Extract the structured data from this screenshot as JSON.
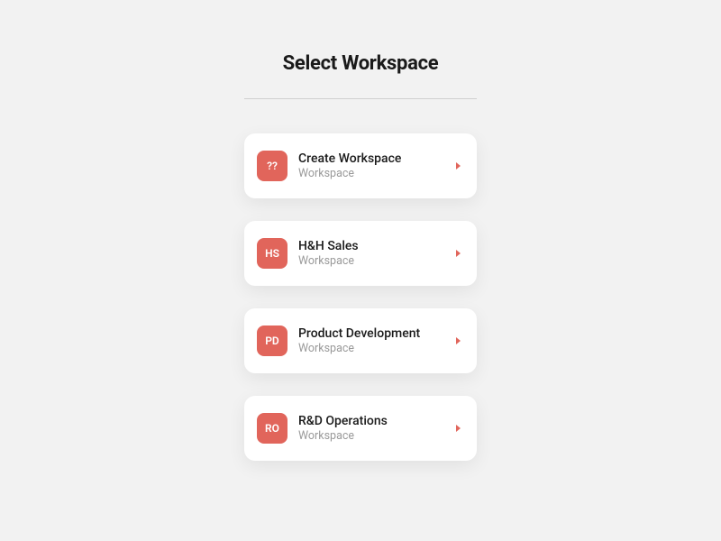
{
  "title": "Select Workspace",
  "subtitle_label": "Workspace",
  "colors": {
    "accent": "#e1655b"
  },
  "workspaces": [
    {
      "abbrev": "??",
      "name": "Create Workspace"
    },
    {
      "abbrev": "HS",
      "name": "H&H Sales"
    },
    {
      "abbrev": "PD",
      "name": "Product Development"
    },
    {
      "abbrev": "RO",
      "name": "R&D Operations"
    }
  ]
}
